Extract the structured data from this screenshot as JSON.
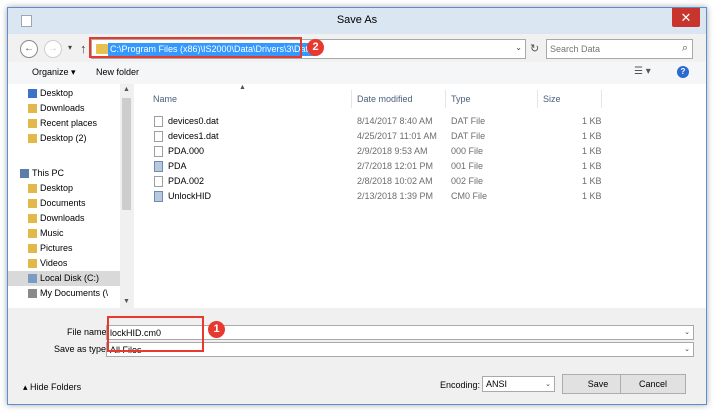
{
  "window": {
    "title": "Save As",
    "close_glyph": "✕"
  },
  "navbar": {
    "back_glyph": "←",
    "forward_glyph": "→",
    "recent_glyph": "▾",
    "up_glyph": "↑",
    "address_path": "C:\\Program Files (x86)\\IS2000\\Data\\Drivers\\3\\Data",
    "dropdown_glyph": "⌄",
    "refresh_glyph": "↻",
    "search_placeholder": "Search Data",
    "search_glyph": "⌕"
  },
  "toolbar": {
    "organize_label": "Organize ▾",
    "new_folder_label": "New folder",
    "view_glyph": "☰ ▾",
    "help_glyph": "?"
  },
  "nav_pane": {
    "items": [
      {
        "label": "Desktop",
        "icon": "desktop-icon",
        "color": "#3b74c6"
      },
      {
        "label": "Downloads",
        "icon": "downloads-icon",
        "color": "#e2b84a"
      },
      {
        "label": "Recent places",
        "icon": "recent-places-icon",
        "color": "#e2b84a"
      },
      {
        "label": "Desktop (2)",
        "icon": "folder-icon",
        "color": "#e2b84a"
      },
      {
        "label": "This PC",
        "icon": "this-pc-icon",
        "color": "#5a7ea8"
      },
      {
        "label": "Desktop",
        "icon": "desktop-icon",
        "color": "#e2b84a"
      },
      {
        "label": "Documents",
        "icon": "documents-icon",
        "color": "#e2b84a"
      },
      {
        "label": "Downloads",
        "icon": "downloads-icon",
        "color": "#e2b84a"
      },
      {
        "label": "Music",
        "icon": "music-icon",
        "color": "#e2b84a"
      },
      {
        "label": "Pictures",
        "icon": "pictures-icon",
        "color": "#e2b84a"
      },
      {
        "label": "Videos",
        "icon": "videos-icon",
        "color": "#e2b84a"
      },
      {
        "label": "Local Disk (C:)",
        "icon": "drive-icon",
        "color": "#7a9cc4"
      },
      {
        "label": "My Documents (\\",
        "icon": "network-drive-icon",
        "color": "#8a8a8a"
      }
    ],
    "scroll_up_glyph": "▲",
    "scroll_down_glyph": "▼"
  },
  "file_list": {
    "sort_glyph": "▲",
    "columns": [
      "Name",
      "Date modified",
      "Type",
      "Size"
    ],
    "rows": [
      {
        "name": "devices0.dat",
        "date": "8/14/2017 8:40 AM",
        "type": "DAT File",
        "size": "1 KB",
        "icon": "file-icon"
      },
      {
        "name": "devices1.dat",
        "date": "4/25/2017 11:01 AM",
        "type": "DAT File",
        "size": "1 KB",
        "icon": "file-icon"
      },
      {
        "name": "PDA.000",
        "date": "2/9/2018 9:53 AM",
        "type": "000 File",
        "size": "1 KB",
        "icon": "file-icon"
      },
      {
        "name": "PDA",
        "date": "2/7/2018 12:01 PM",
        "type": "001 File",
        "size": "1 KB",
        "icon": "app-file-icon"
      },
      {
        "name": "PDA.002",
        "date": "2/8/2018 10:02 AM",
        "type": "002 File",
        "size": "1 KB",
        "icon": "file-icon"
      },
      {
        "name": "UnlockHID",
        "date": "2/13/2018 1:39 PM",
        "type": "CM0 File",
        "size": "1 KB",
        "icon": "app-file-icon"
      }
    ]
  },
  "save_panel": {
    "file_name_label": "File name:",
    "file_name_value": "lockHID.cm0",
    "save_type_label": "Save as type:",
    "save_type_value": "All Files",
    "combo_glyph": "⌄",
    "hide_folders_label": "Hide Folders",
    "hide_folders_glyph": "▴",
    "encoding_label": "Encoding:",
    "encoding_value": "ANSI",
    "save_button": "Save",
    "cancel_button": "Cancel"
  },
  "annotations": {
    "badge_1": "1",
    "badge_2": "2",
    "callout_color": "#e8392f"
  }
}
